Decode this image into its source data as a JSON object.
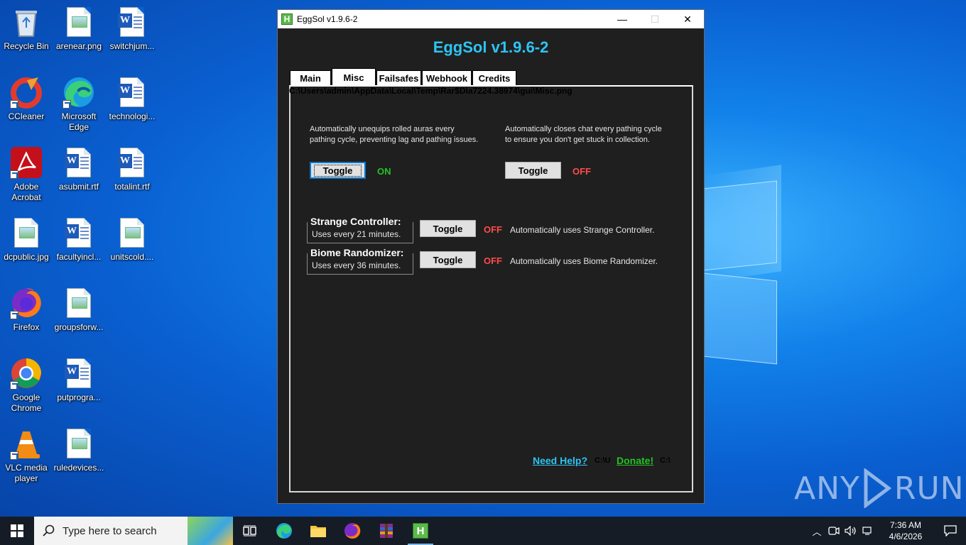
{
  "desktop": {
    "icons": [
      {
        "label": "Recycle Bin"
      },
      {
        "label": "arenear.png"
      },
      {
        "label": "switchjum..."
      },
      {
        "label": "CCleaner"
      },
      {
        "label": "Microsoft Edge"
      },
      {
        "label": "technologi..."
      },
      {
        "label": "Adobe Acrobat"
      },
      {
        "label": "asubmit.rtf"
      },
      {
        "label": "totalint.rtf"
      },
      {
        "label": "dcpublic.jpg"
      },
      {
        "label": "facultyincl..."
      },
      {
        "label": "unitscold...."
      },
      {
        "label": "Firefox"
      },
      {
        "label": "groupsforw..."
      },
      {
        "label": "Google Chrome"
      },
      {
        "label": "putprogra..."
      },
      {
        "label": "VLC media player"
      },
      {
        "label": "ruledevices..."
      }
    ],
    "watermark": {
      "left": "ANY",
      "right": "RUN"
    }
  },
  "window": {
    "title": "EggSol v1.9.6-2",
    "controls": {
      "minimize": "—",
      "maximize": "☐",
      "close": "✕"
    },
    "app_heading": "EggSol v1.9.6-2",
    "tabs": [
      {
        "label": "Main",
        "active": false
      },
      {
        "label": "Misc",
        "active": true
      },
      {
        "label": "Failsafes",
        "active": false
      },
      {
        "label": "Webhook",
        "active": false
      },
      {
        "label": "Credits",
        "active": false
      }
    ],
    "broken_image_path": "C:\\Users\\admin\\AppData\\Local\\Temp\\Rar$DIa7224.38974\\gui\\Misc.png",
    "options": {
      "unequip": {
        "description": "Automatically unequips rolled auras every pathing cycle, preventing lag and pathing issues.",
        "button": "Toggle",
        "state": "ON"
      },
      "close_chat": {
        "description": "Automatically closes chat every pathing cycle to ensure you don't get stuck in collection.",
        "button": "Toggle",
        "state": "OFF"
      }
    },
    "items": {
      "strange_controller": {
        "title": "Strange Controller:",
        "interval": "Uses every 21 minutes.",
        "button": "Toggle",
        "state": "OFF",
        "description": "Automatically uses Strange Controller."
      },
      "biome_randomizer": {
        "title": "Biome Randomizer:",
        "interval": "Uses every 36 minutes.",
        "button": "Toggle",
        "state": "OFF",
        "description": "Automatically uses Biome Randomizer."
      }
    },
    "footer": {
      "help_link": "Need Help?",
      "help_stub": "C:\\U",
      "donate_link": "Donate!",
      "donate_stub": "C:\\"
    }
  },
  "taskbar": {
    "search_placeholder": "Type here to search",
    "pinned": [
      "task-view",
      "microsoft-edge",
      "file-explorer",
      "firefox",
      "winrar",
      "eggsol"
    ],
    "clock": {
      "time": "7:36 AM",
      "date": "4/6/2026"
    }
  },
  "colors": {
    "accent": "#2ec4f2",
    "on": "#22c322",
    "off": "#ff4b4b",
    "client_bg": "#1f1f1f"
  }
}
